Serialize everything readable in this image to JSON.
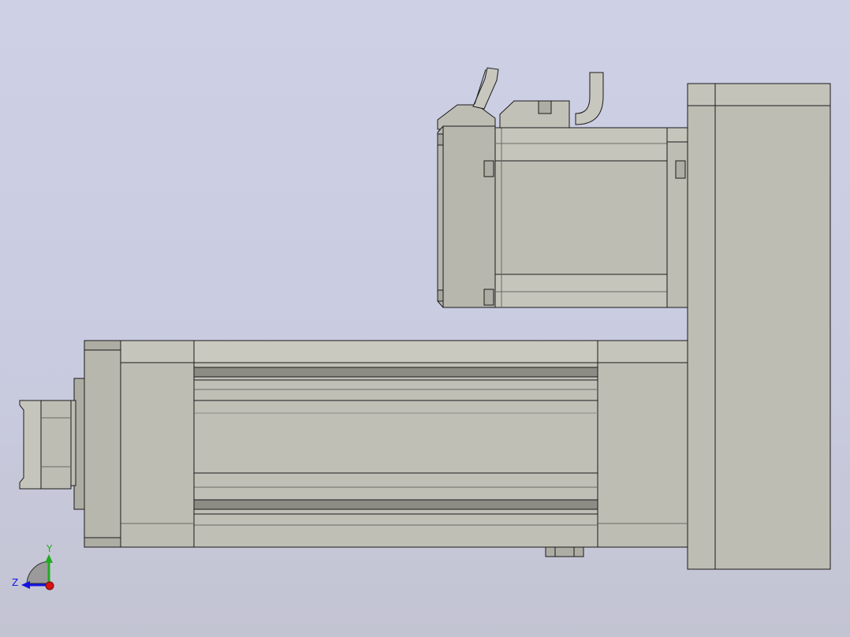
{
  "view": {
    "background_top": "#ced0e6",
    "background_bottom": "#c3c4d2",
    "part_color": "#bebdb4",
    "part_dark": "#aeada4",
    "edge_color": "#1a1a1a"
  },
  "triad": {
    "y_label": "Y",
    "z_label": "Z",
    "y_color": "#22aa22",
    "z_color": "#1515dd",
    "x_color": "#dd1111"
  }
}
